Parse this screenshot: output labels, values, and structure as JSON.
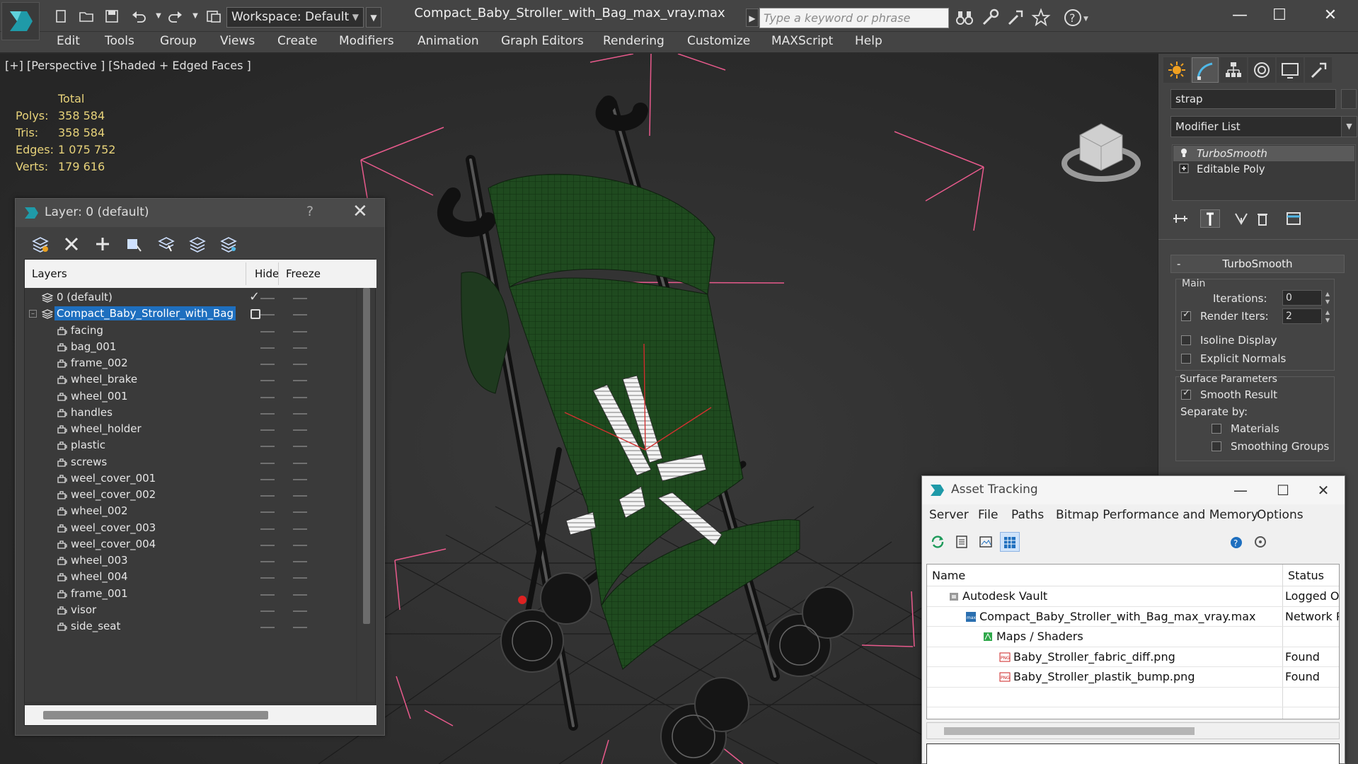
{
  "titlebar": {
    "workspace": "Workspace: Default",
    "file_title": "Compact_Baby_Stroller_with_Bag_max_vray.max",
    "search_placeholder": "Type a keyword or phrase"
  },
  "menu": [
    "Edit",
    "Tools",
    "Group",
    "Views",
    "Create",
    "Modifiers",
    "Animation",
    "Graph Editors",
    "Rendering",
    "Customize",
    "MAXScript",
    "Help"
  ],
  "viewport": {
    "label": "[+] [Perspective ] [Shaded + Edged Faces ]",
    "stats_header": "Total",
    "stats": [
      {
        "k": "Polys:",
        "v": "358 584"
      },
      {
        "k": "Tris:",
        "v": "358 584"
      },
      {
        "k": "Edges:",
        "v": "1 075 752"
      },
      {
        "k": "Verts:",
        "v": "179 616"
      }
    ],
    "colors": {
      "bounding_box": "#e85a8c",
      "grid": "#1a1a1a",
      "mesh": "#2f5a2a"
    }
  },
  "command_panel": {
    "object_name": "strap",
    "modifier_list": "Modifier List",
    "stack": [
      "TurboSmooth",
      "Editable Poly"
    ],
    "turbosmooth": {
      "title": "TurboSmooth",
      "collapse": "-",
      "main_label": "Main",
      "iterations_label": "Iterations:",
      "iterations": "0",
      "render_iters_label": "Render Iters:",
      "render_iters": "2",
      "render_iters_on": true,
      "isoline_display": "Isoline Display",
      "explicit_normals": "Explicit Normals",
      "surface_params": "Surface Parameters",
      "smooth_result": "Smooth Result",
      "separate_by": "Separate by:",
      "materials": "Materials",
      "smoothing_groups": "Smoothing Groups"
    }
  },
  "layer_window": {
    "title": "Layer: 0 (default)",
    "help": "?",
    "close": "✕",
    "columns": {
      "layers": "Layers",
      "hide": "Hide",
      "freeze": "Freeze"
    },
    "rows": [
      {
        "name": "0 (default)",
        "level": 0,
        "kind": "layer",
        "mark": "tick"
      },
      {
        "name": "Compact_Baby_Stroller_with_Bag",
        "level": 0,
        "kind": "layer",
        "selected": true,
        "mark": "box",
        "expander": "–"
      },
      {
        "name": "facing",
        "level": 1,
        "kind": "object"
      },
      {
        "name": "bag_001",
        "level": 1,
        "kind": "object"
      },
      {
        "name": "frame_002",
        "level": 1,
        "kind": "object"
      },
      {
        "name": "wheel_brake",
        "level": 1,
        "kind": "object"
      },
      {
        "name": "wheel_001",
        "level": 1,
        "kind": "object"
      },
      {
        "name": "handles",
        "level": 1,
        "kind": "object"
      },
      {
        "name": "wheel_holder",
        "level": 1,
        "kind": "object"
      },
      {
        "name": "plastic",
        "level": 1,
        "kind": "object"
      },
      {
        "name": "screws",
        "level": 1,
        "kind": "object"
      },
      {
        "name": "weel_cover_001",
        "level": 1,
        "kind": "object"
      },
      {
        "name": "weel_cover_002",
        "level": 1,
        "kind": "object"
      },
      {
        "name": "wheel_002",
        "level": 1,
        "kind": "object"
      },
      {
        "name": "weel_cover_003",
        "level": 1,
        "kind": "object"
      },
      {
        "name": "weel_cover_004",
        "level": 1,
        "kind": "object"
      },
      {
        "name": "wheel_003",
        "level": 1,
        "kind": "object"
      },
      {
        "name": "wheel_004",
        "level": 1,
        "kind": "object"
      },
      {
        "name": "frame_001",
        "level": 1,
        "kind": "object"
      },
      {
        "name": "visor",
        "level": 1,
        "kind": "object"
      },
      {
        "name": "side_seat",
        "level": 1,
        "kind": "object"
      }
    ]
  },
  "asset_window": {
    "title": "Asset Tracking",
    "controls": {
      "minimize": "—",
      "maximize": "☐",
      "close": "✕"
    },
    "menu": [
      "Server",
      "File",
      "Paths",
      "Bitmap Performance and Memory",
      "Options"
    ],
    "columns": {
      "name": "Name",
      "status": "Status"
    },
    "rows": [
      {
        "name": "Autodesk Vault",
        "status": "Logged Ou",
        "level": 0,
        "icon": "vault-icon"
      },
      {
        "name": "Compact_Baby_Stroller_with_Bag_max_vray.max",
        "status": "Network P",
        "level": 1,
        "icon": "max-file-icon"
      },
      {
        "name": "Maps / Shaders",
        "status": "",
        "level": 2,
        "icon": "maps-icon"
      },
      {
        "name": "Baby_Stroller_fabric_diff.png",
        "status": "Found",
        "level": 3,
        "icon": "png-icon"
      },
      {
        "name": "Baby_Stroller_plastik_bump.png",
        "status": "Found",
        "level": 3,
        "icon": "png-icon"
      }
    ]
  }
}
